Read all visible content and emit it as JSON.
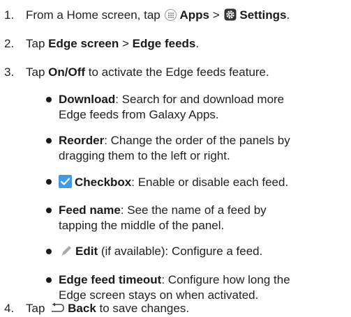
{
  "steps": [
    {
      "number": "1.",
      "prefix": "From a Home screen, tap",
      "apps_label": "Apps",
      "separator": ">",
      "settings_label": "Settings",
      "end": "."
    },
    {
      "number": "2.",
      "prefix": "Tap",
      "edge_screen": "Edge screen",
      "separator": ">",
      "edge_feeds": "Edge feeds",
      "end": "."
    },
    {
      "number": "3.",
      "prefix": "Tap",
      "onoff": "On/Off",
      "suffix": "to activate the Edge feeds feature."
    },
    {
      "number": "4.",
      "prefix": "Tap",
      "back_label": "Back",
      "suffix": "to save changes."
    }
  ],
  "bullets": {
    "download": {
      "term": "Download",
      "line1": ": Search for and download more",
      "line2": "Edge feeds from Galaxy Apps."
    },
    "reorder": {
      "term": "Reorder",
      "line1": ": Change the order of the panels by",
      "line2": "dragging them to the left or right."
    },
    "checkbox": {
      "term": "Checkbox",
      "line1": ": Enable or disable each feed."
    },
    "feed_name": {
      "term": "Feed name",
      "line1": ": See the name of a feed by",
      "line2": "tapping the middle of the panel."
    },
    "edit": {
      "term": "Edit",
      "line1": "(if available): Configure a feed."
    },
    "timeout": {
      "term": "Edge feed timeout",
      "line1": ": Configure how long the",
      "line2": "Edge screen stays on when activated."
    }
  },
  "icons": {
    "apps": "apps-icon",
    "settings": "settings-gear-icon",
    "checkbox": "checkbox-checked-icon",
    "edit": "pencil-icon",
    "back": "back-arrow-icon"
  },
  "colors": {
    "checkbox": "#3d9be9",
    "pencil": "#a9a9a9",
    "text": "#222222"
  }
}
